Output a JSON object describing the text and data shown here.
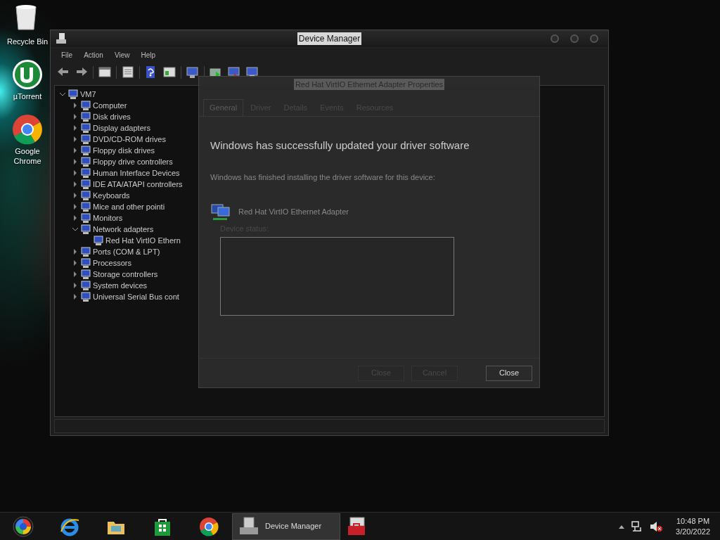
{
  "desktop_icons": [
    {
      "kind": "recycle",
      "label": "Recycle Bin"
    },
    {
      "kind": "torrent",
      "label": "µTorrent"
    },
    {
      "kind": "chrome",
      "label": "Google Chrome"
    }
  ],
  "device_manager": {
    "title": "Device Manager",
    "menu": [
      "File",
      "Action",
      "View",
      "Help"
    ],
    "tree": {
      "label": "VM7",
      "expanded": true,
      "children": [
        {
          "label": "Computer",
          "expanded": false
        },
        {
          "label": "Disk drives",
          "expanded": false
        },
        {
          "label": "Display adapters",
          "expanded": false
        },
        {
          "label": "DVD/CD-ROM drives",
          "expanded": false
        },
        {
          "label": "Floppy disk drives",
          "expanded": false
        },
        {
          "label": "Floppy drive controllers",
          "expanded": false
        },
        {
          "label": "Human Interface Devices",
          "expanded": false
        },
        {
          "label": "IDE ATA/ATAPI controllers",
          "expanded": false
        },
        {
          "label": "Keyboards",
          "expanded": false
        },
        {
          "label": "Mice and other pointi",
          "expanded": false
        },
        {
          "label": "Monitors",
          "expanded": false
        },
        {
          "label": "Network adapters",
          "expanded": true,
          "children": [
            {
              "label": "Red Hat VirtIO Ethern"
            }
          ]
        },
        {
          "label": "Ports (COM & LPT)",
          "expanded": false
        },
        {
          "label": "Processors",
          "expanded": false
        },
        {
          "label": "Storage controllers",
          "expanded": false
        },
        {
          "label": "System devices",
          "expanded": false
        },
        {
          "label": "Universal Serial Bus cont",
          "expanded": false
        }
      ]
    }
  },
  "properties_dialog": {
    "title": "Red Hat VirtIO Ethernet Adapter Properties",
    "tabs": [
      {
        "label": "General",
        "selected": true
      },
      {
        "label": "Driver",
        "selected": false
      },
      {
        "label": "Details",
        "selected": false
      },
      {
        "label": "Events",
        "selected": false
      },
      {
        "label": "Resources",
        "selected": false
      }
    ],
    "device_status_label": "Device status:",
    "buttons": [
      "Close",
      "Cancel"
    ]
  },
  "wizard": {
    "heading": "Windows has successfully updated your driver software",
    "message": "Windows has finished installing the driver software for this device:",
    "device": "Red Hat VirtIO Ethernet Adapter",
    "button": "Close"
  },
  "taskbar": {
    "pinned": [
      {
        "kind": "start"
      },
      {
        "kind": "ie"
      },
      {
        "kind": "explorer"
      },
      {
        "kind": "store"
      },
      {
        "kind": "chrome"
      }
    ],
    "windows": [
      {
        "kind": "devmgr",
        "label": "Device Manager",
        "selected": true
      },
      {
        "kind": "toolbox",
        "selected": false
      }
    ],
    "time": "10:48 PM",
    "date": "3/20/2022"
  }
}
